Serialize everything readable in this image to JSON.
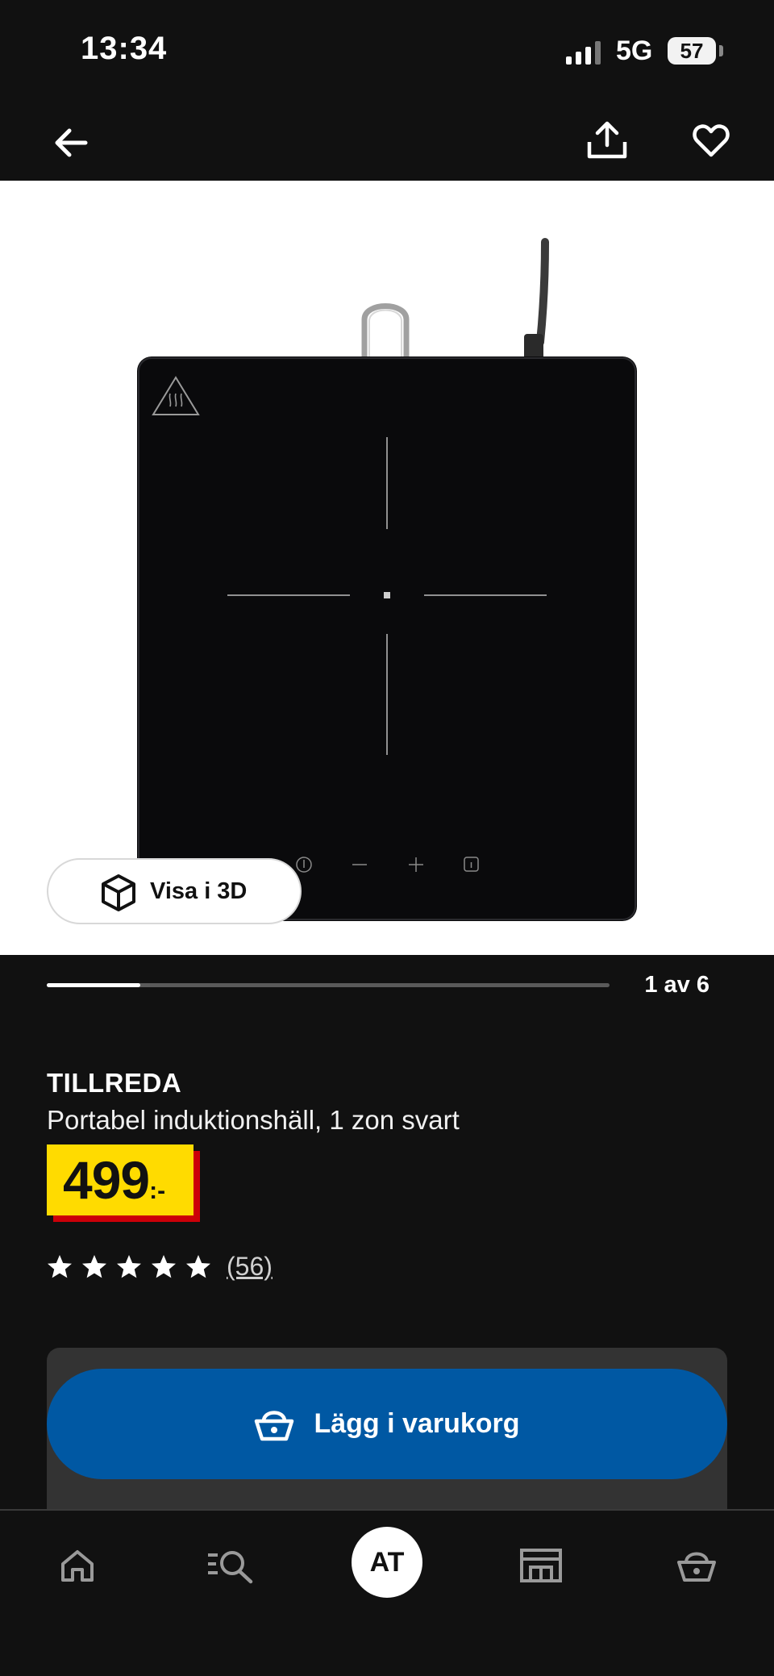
{
  "status_bar": {
    "time": "13:34",
    "network": "5G",
    "battery": "57",
    "icons": [
      "signal-bars-icon",
      "battery-icon"
    ]
  },
  "nav": {
    "icons": [
      "back-arrow-icon",
      "share-icon",
      "heart-icon"
    ]
  },
  "gallery": {
    "view_3d_label": "Visa i 3D",
    "counter": "1 av 6",
    "current_image": 1,
    "total_images": 6,
    "icons": [
      "cube-3d-icon"
    ]
  },
  "product": {
    "name": "TILLREDA",
    "description": "Portabel induktionshäll, 1 zon svart",
    "price_integer": "499",
    "price_suffix": ":-",
    "rating_stars": 5,
    "review_count": "(56)"
  },
  "actions": {
    "add_to_cart_label": "Lägg i varukorg",
    "icons": [
      "basket-icon"
    ]
  },
  "tab_bar": {
    "avatar_initials": "AT",
    "items": [
      "home-icon",
      "search-list-icon",
      "profile-avatar",
      "store-icon",
      "basket-icon"
    ]
  },
  "colors": {
    "background": "#111111",
    "price_yellow": "#ffdb00",
    "price_red": "#cc0008",
    "cart_blue": "#0058a3",
    "card_gray": "#333333"
  }
}
